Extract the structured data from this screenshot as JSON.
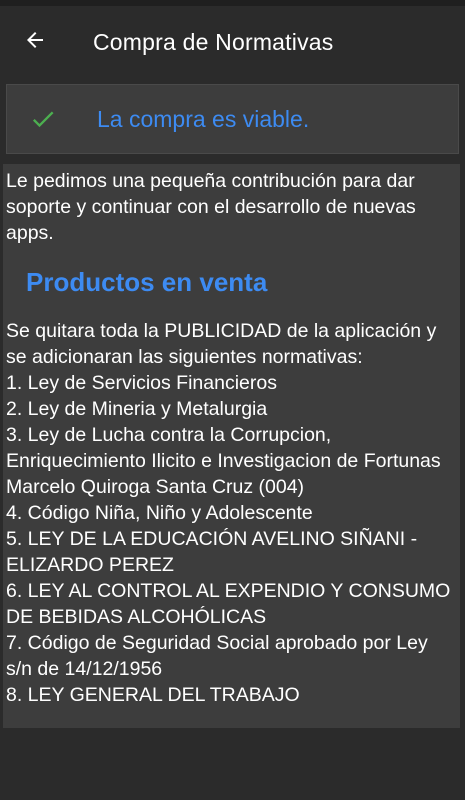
{
  "toolbar": {
    "title": "Compra de Normativas",
    "back_icon": "arrow-left-icon"
  },
  "banner": {
    "icon": "check-icon",
    "text": "La compra es viable.",
    "text_color": "#3d8bf2",
    "icon_color": "#4caf50"
  },
  "content": {
    "intro": "Le pedimos una pequeña contribución para dar soporte y continuar con el desarrollo de nuevas apps.",
    "section_title": "Productos en venta",
    "list_intro": "Se quitara toda la PUBLICIDAD de la aplicación y se adicionaran las siguientes normativas:",
    "items": [
      "1. Ley de Servicios Financieros",
      "2. Ley de Mineria y Metalurgia",
      "3. Ley de Lucha contra la Corrupcion, Enriquecimiento Ilicito e Investigacion de Fortunas Marcelo Quiroga Santa Cruz (004)",
      "4. Código Niña, Niño y Adolescente",
      "5. LEY DE LA EDUCACIÓN AVELINO SIÑANI - ELIZARDO PEREZ",
      "6. LEY AL CONTROL AL EXPENDIO Y CONSUMO DE BEBIDAS ALCOHÓLICAS",
      "7. Código de Seguridad Social aprobado por Ley s/n de 14/12/1956",
      "8. LEY GENERAL DEL TRABAJO"
    ]
  }
}
